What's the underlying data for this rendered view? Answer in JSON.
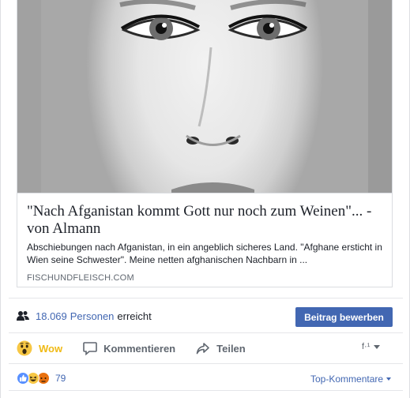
{
  "preview": {
    "title": "\"Nach Afganistan kommt Gott nur noch zum Weinen\"... - von Almann",
    "description": "Abschiebungen nach Afganistan, in ein angeblich sicheres Land. \"Afghane ersticht in Wien seine Schwester\". Meine netten afghanischen Nachbarn in ...",
    "domain": "FISCHUNDFLEISCH.COM",
    "image_alt": "face-photo"
  },
  "reach": {
    "count": "18.069",
    "persons_label": "Personen",
    "suffix": "erreicht",
    "boost_label": "Beitrag bewerben"
  },
  "actions": {
    "wow_label": "Wow",
    "comment_label": "Kommentieren",
    "share_label": "Teilen",
    "language_label": "f·¹"
  },
  "reactions": {
    "count": "79",
    "sort_label": "Top-Kommentare",
    "icons": [
      "like-icon",
      "haha-icon",
      "angry-icon"
    ]
  },
  "colors": {
    "accent": "#4267b2",
    "wow": "#f0ba15",
    "secondary_text": "#606770"
  }
}
